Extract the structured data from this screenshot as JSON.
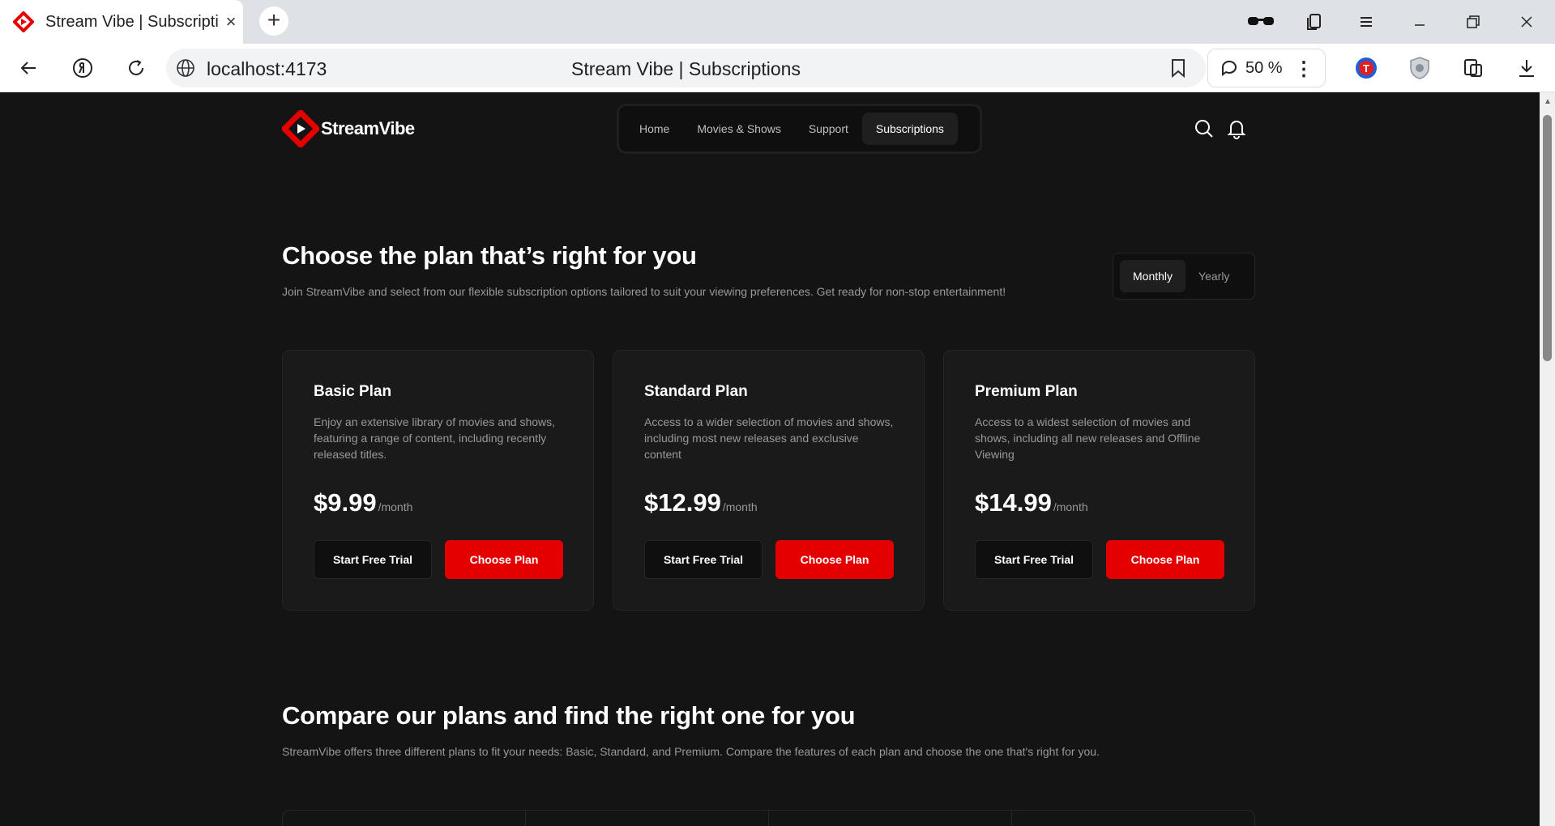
{
  "browser": {
    "tab_title": "Stream Vibe | Subscriptions",
    "tab_close": "×",
    "new_tab": "+",
    "url": "localhost:4173",
    "page_title": "Stream Vibe | Subscriptions",
    "zoom": "50 %"
  },
  "header": {
    "logo_text": "StreamVibe",
    "nav": [
      "Home",
      "Movies & Shows",
      "Support",
      "Subscriptions"
    ],
    "active_nav": "Subscriptions"
  },
  "plans_section": {
    "title": "Choose the plan that’s right for you",
    "subtitle": "Join StreamVibe and select from our flexible subscription options tailored to suit your viewing preferences. Get ready for non-stop entertainment!",
    "billing_options": [
      "Monthly",
      "Yearly"
    ],
    "billing_selected": "Monthly",
    "plans": [
      {
        "name": "Basic Plan",
        "description": "Enjoy an extensive library of movies and shows, featuring a range of content, including recently released titles.",
        "price": "$9.99",
        "period": "/month",
        "trial_label": "Start Free Trial",
        "choose_label": "Choose Plan"
      },
      {
        "name": "Standard Plan",
        "description": "Access to a wider selection of movies and shows, including most new releases and exclusive content",
        "price": "$12.99",
        "period": "/month",
        "trial_label": "Start Free Trial",
        "choose_label": "Choose Plan"
      },
      {
        "name": "Premium Plan",
        "description": "Access to a widest selection of movies and shows, including all new releases and Offline Viewing",
        "price": "$14.99",
        "period": "/month",
        "trial_label": "Start Free Trial",
        "choose_label": "Choose Plan"
      }
    ]
  },
  "compare_section": {
    "title": "Compare our plans and find the right one for you",
    "subtitle": "StreamVibe offers three different plans to fit your needs: Basic, Standard, and Premium. Compare the features of each plan and choose the one that's right for you."
  },
  "colors": {
    "background": "#141414",
    "card": "#1a1a1a",
    "accent": "#e50000",
    "muted_text": "#999999"
  }
}
